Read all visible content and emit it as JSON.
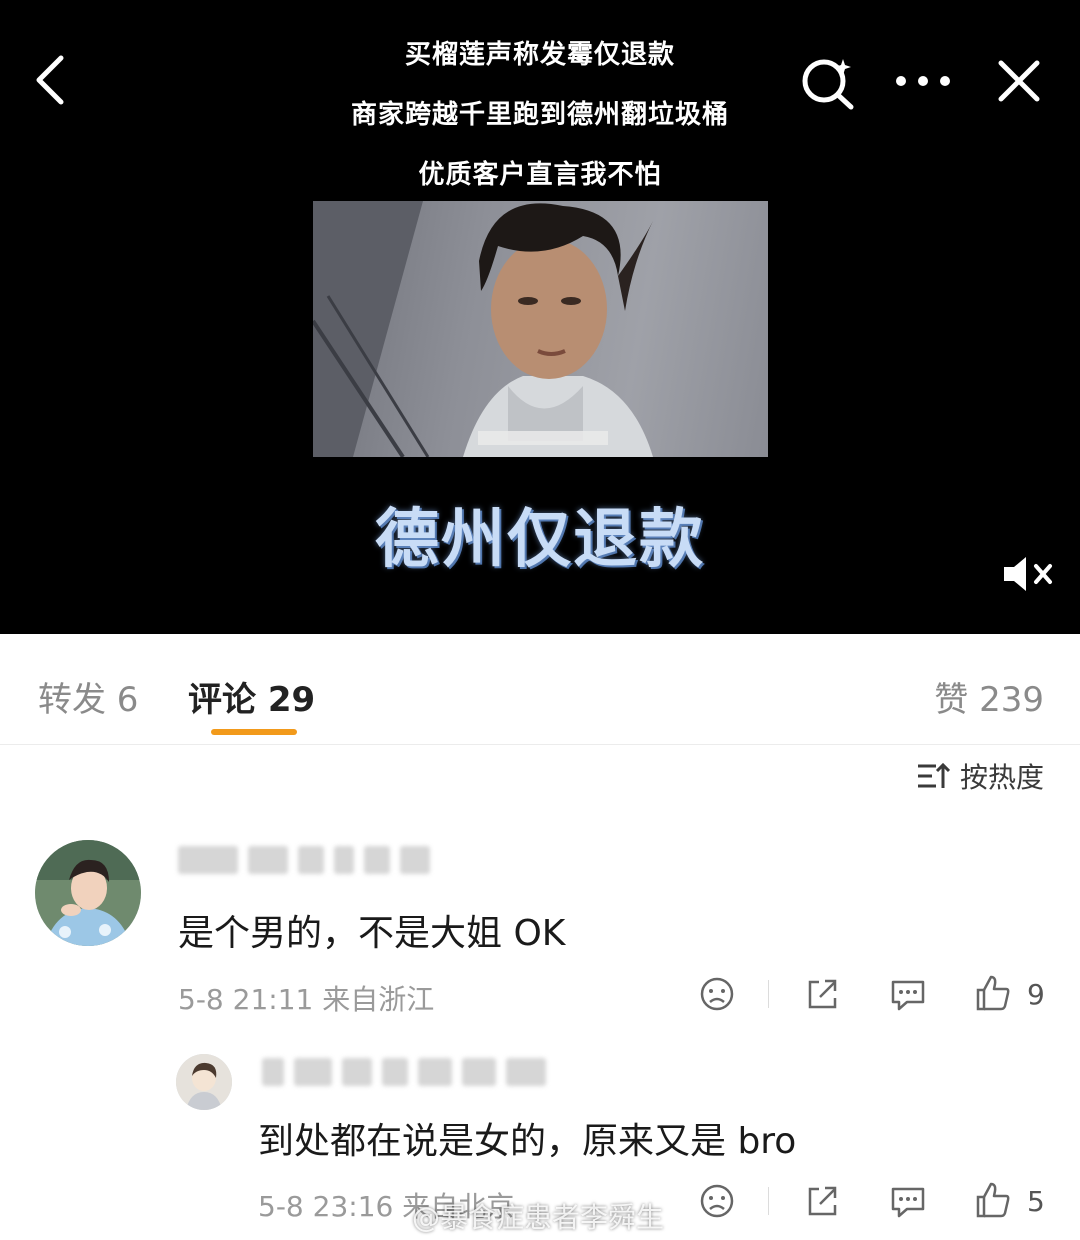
{
  "video": {
    "caption_lines": [
      "买榴莲声称发霉仅退款",
      "商家跨越千里跑到德州翻垃圾桶",
      "优质客户直言我不怕"
    ],
    "big_title": "德州仅退款"
  },
  "icons": {
    "back": "chevron-left-icon",
    "search": "search-sparkle-icon",
    "more": "more-dots-icon",
    "close": "close-icon",
    "mute": "speaker-muted-icon",
    "sort": "sort-icon",
    "dislike": "sad-face-icon",
    "share": "share-icon",
    "reply": "comment-bubble-icon",
    "like": "thumbs-up-icon"
  },
  "tabs": {
    "repost": "转发 6",
    "comments": "评论 29",
    "likes": "赞 239"
  },
  "sort_label": "按热度",
  "comments": [
    {
      "text": "是个男的，不是大姐 OK",
      "meta": "5-8 21:11 来自浙江",
      "likes": "9"
    },
    {
      "text": "到处都在说是女的，原来又是 bro",
      "meta": "5-8 23:16 来自北京",
      "likes": "5"
    }
  ],
  "watermark": "@暴食症患者李舜生",
  "colors": {
    "accent": "#f29a1b",
    "title_blue": "#c8dcf6"
  }
}
